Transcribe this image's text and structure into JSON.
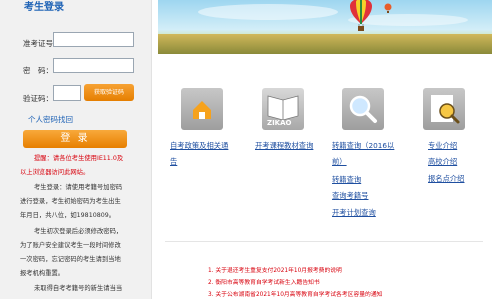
{
  "login": {
    "title": "考生登录",
    "exam_no_label": "准考证号：",
    "password_label": "密　码：",
    "captcha_label": "验证码：",
    "captcha_button": "获取验证码",
    "forgot_link": "个人密码找回",
    "login_button": "登 录",
    "tip_red_1": "提醒：请各位考生使用IE11.0及",
    "tip_red_2": "以上浏览器访问此网站。",
    "tip_1": "考生登录：请使用考籍号加密码",
    "tip_2": "进行登录，考生初始密码为考生出生",
    "tip_3": "年月日，共八位，如19810809。",
    "tip_4": "考生初次登录后必须修改密码，",
    "tip_5": "为了账户安全建议考生一段时间修改",
    "tip_6": "一次密码，忘记密码的考生请到当地",
    "tip_7": "报考机构重置。",
    "tip_8": "未取得自考考籍号的新生请当当"
  },
  "nav": {
    "policy": "自考政策及相关通",
    "policy_2": "告",
    "textbook": "开考课程教材查询",
    "transfer": "转籍查询（2016以",
    "transfer_2": "前）",
    "transfer_query": "转籍查询",
    "exam_no_query": "查询考籍号",
    "plan_query": "开考计划查询",
    "major_intro": "专业介绍",
    "school_intro": "高校介绍",
    "report_intro": "报名点介绍",
    "zikao_text": "ZIKAO"
  },
  "news": [
    "1. 关于退还考生重复支付2021年10月报考费的说明",
    "2. 衡阳市高等教育自学考试新生入籍告知书",
    "3. 关于公布湖南省2021年10月高等教育自学考试各考区容量的通知"
  ],
  "colors": {
    "accent_blue": "#1f63b6",
    "button_orange": "#ee8f10",
    "red_text": "#d8000c"
  }
}
